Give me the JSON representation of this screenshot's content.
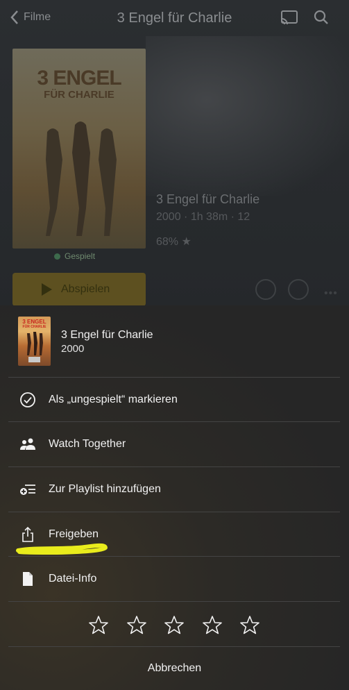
{
  "topbar": {
    "back_label": "Filme",
    "title": "3 Engel für Charlie"
  },
  "background": {
    "poster_title_line1": "3 ENGEL",
    "poster_title_line2": "FÜR CHARLIE",
    "played_label": "Gespielt",
    "movie_title": "3 Engel für Charlie",
    "movie_meta": "2000  ·  1h 38m  ·  12",
    "movie_rating": "68% ★",
    "play_button_label": "Abspielen"
  },
  "sheet": {
    "thumb_line1": "3 ENGEL",
    "thumb_line2": "FÜR CHARLIE",
    "title": "3 Engel für Charlie",
    "year": "2000",
    "items": [
      {
        "label": "Als „ungespielt“ markieren",
        "icon": "check-circle-icon"
      },
      {
        "label": "Watch Together",
        "icon": "people-icon"
      },
      {
        "label": "Zur Playlist hinzufügen",
        "icon": "playlist-add-icon"
      },
      {
        "label": "Freigeben",
        "icon": "share-icon"
      },
      {
        "label": "Datei-Info",
        "icon": "file-icon"
      }
    ],
    "rating_stars": 5,
    "rating_value": 0,
    "cancel_label": "Abbrechen"
  },
  "colors": {
    "sheet_bg": "#2c2a26",
    "text": "#f2f2f2",
    "divider": "#444444",
    "highlight": "#e9ec1c"
  }
}
